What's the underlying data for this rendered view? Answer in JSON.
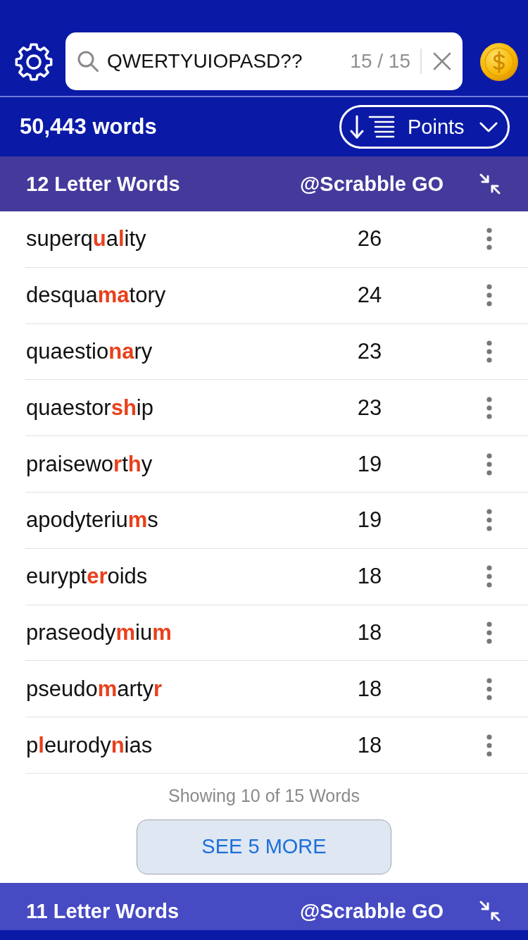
{
  "toolbar": {
    "search": {
      "value": "QWERTYUIOPASD??",
      "count": "15 / 15"
    }
  },
  "summary": {
    "word_count": "50,443 words",
    "sort": {
      "label": "Points"
    }
  },
  "sections": [
    {
      "title": "12 Letter Words",
      "source": "@Scrabble GO",
      "color": "#443a9c",
      "words": [
        {
          "word": "superq**u**a**l**ity",
          "points": "26"
        },
        {
          "word": "desqua**ma**tory",
          "points": "24"
        },
        {
          "word": "quaestio**na**ry",
          "points": "23"
        },
        {
          "word": "quaestor**sh**ip",
          "points": "23"
        },
        {
          "word": "praisewo**r**t**h**y",
          "points": "19"
        },
        {
          "word": "apodyteriu**m**s",
          "points": "19"
        },
        {
          "word": "eurypt**er**oids",
          "points": "18"
        },
        {
          "word": "praseody**m**iu**m**",
          "points": "18"
        },
        {
          "word": "pseudo**m**arty**r**",
          "points": "18"
        },
        {
          "word": "p**l**eurody**n**ias",
          "points": "18"
        }
      ],
      "footer": {
        "showing": "Showing 10 of 15 Words",
        "button": "SEE 5 MORE"
      }
    },
    {
      "title": "11 Letter Words",
      "source": "@Scrabble GO",
      "color": "#464ac3"
    }
  ]
}
